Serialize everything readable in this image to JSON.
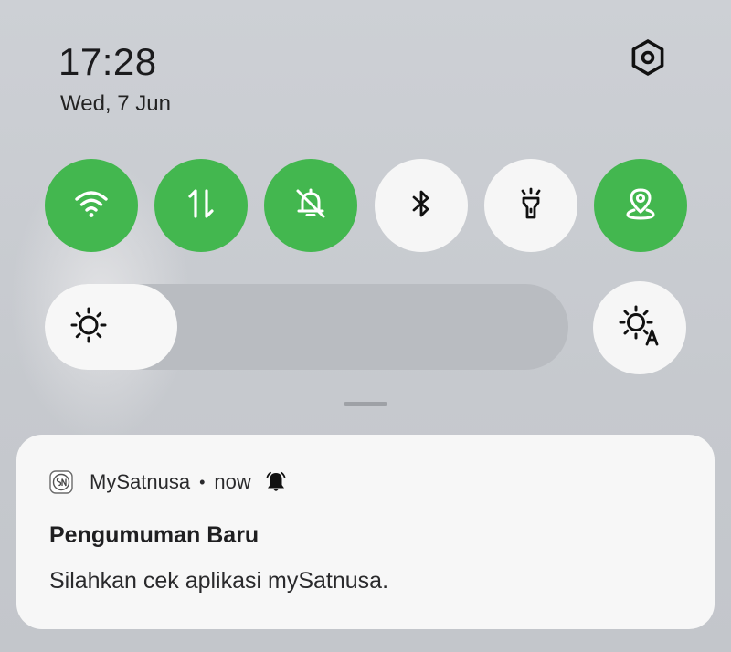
{
  "status": {
    "time": "17:28",
    "date": "Wed, 7 Jun"
  },
  "quick_tiles": [
    {
      "name": "wifi",
      "icon": "wifi-icon",
      "state": "on"
    },
    {
      "name": "mobile-data",
      "icon": "data-transfer-icon",
      "state": "on"
    },
    {
      "name": "silent",
      "icon": "bell-off-icon",
      "state": "on"
    },
    {
      "name": "bluetooth",
      "icon": "bluetooth-icon",
      "state": "off"
    },
    {
      "name": "flashlight",
      "icon": "flashlight-icon",
      "state": "off"
    },
    {
      "name": "location",
      "icon": "location-icon",
      "state": "on"
    }
  ],
  "brightness": {
    "level": 0.25,
    "icon": "sun-icon",
    "auto_icon": "auto-brightness-icon"
  },
  "colors": {
    "tile_on": "#43b74f",
    "tile_off": "#f6f6f6"
  },
  "notification": {
    "app_name": "MySatnusa",
    "separator": "•",
    "time": "now",
    "title": "Pengumuman Baru",
    "body": "Silahkan cek aplikasi mySatnusa."
  }
}
